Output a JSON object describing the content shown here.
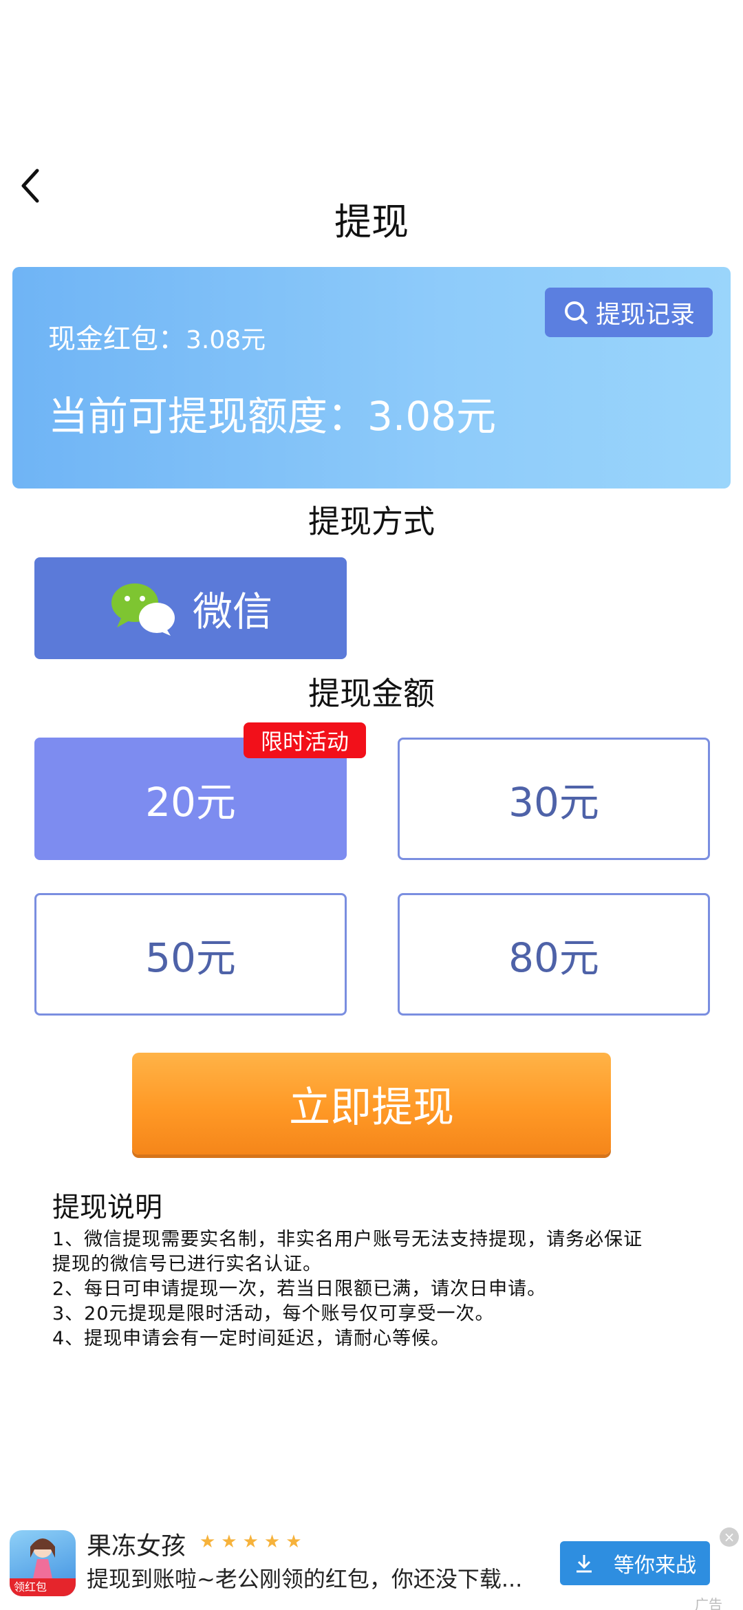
{
  "header": {
    "title": "提现"
  },
  "balance": {
    "record_button": "提现记录",
    "cash_label": "现金红包：",
    "cash_value": "3.08元",
    "available_label": "当前可提现额度：",
    "available_value": "3.08元"
  },
  "method": {
    "section_title": "提现方式",
    "wechat_label": "微信"
  },
  "amount": {
    "section_title": "提现金额",
    "promo_tag": "限时活动",
    "options": [
      "20元",
      "30元",
      "50元",
      "80元"
    ],
    "selected_index": 0
  },
  "submit_label": "立即提现",
  "notes": {
    "title": "提现说明",
    "lines": [
      "1、微信提现需要实名制，非实名用户账号无法支持提现，请务必保证",
      "提现的微信号已进行实名认证。",
      "2、每日可申请提现一次，若当日限额已满，请次日申请。",
      "3、20元提现是限时活动，每个账号仅可享受一次。",
      "4、提现申请会有一定时间延迟，请耐心等候。"
    ]
  },
  "ad": {
    "avatar_tag": "领红包",
    "app_name": "果冻女孩",
    "rating_stars": "★★★★★",
    "description": "提现到账啦~老公刚领的红包，你还没下载...",
    "button_label": "等你来战",
    "ad_label": "广告",
    "close_symbol": "×"
  },
  "colors": {
    "accent_blue": "#5b7ad9",
    "selected_amount": "#7d8cf0",
    "promo_red": "#f2101a",
    "submit_orange": "#ff9926"
  }
}
